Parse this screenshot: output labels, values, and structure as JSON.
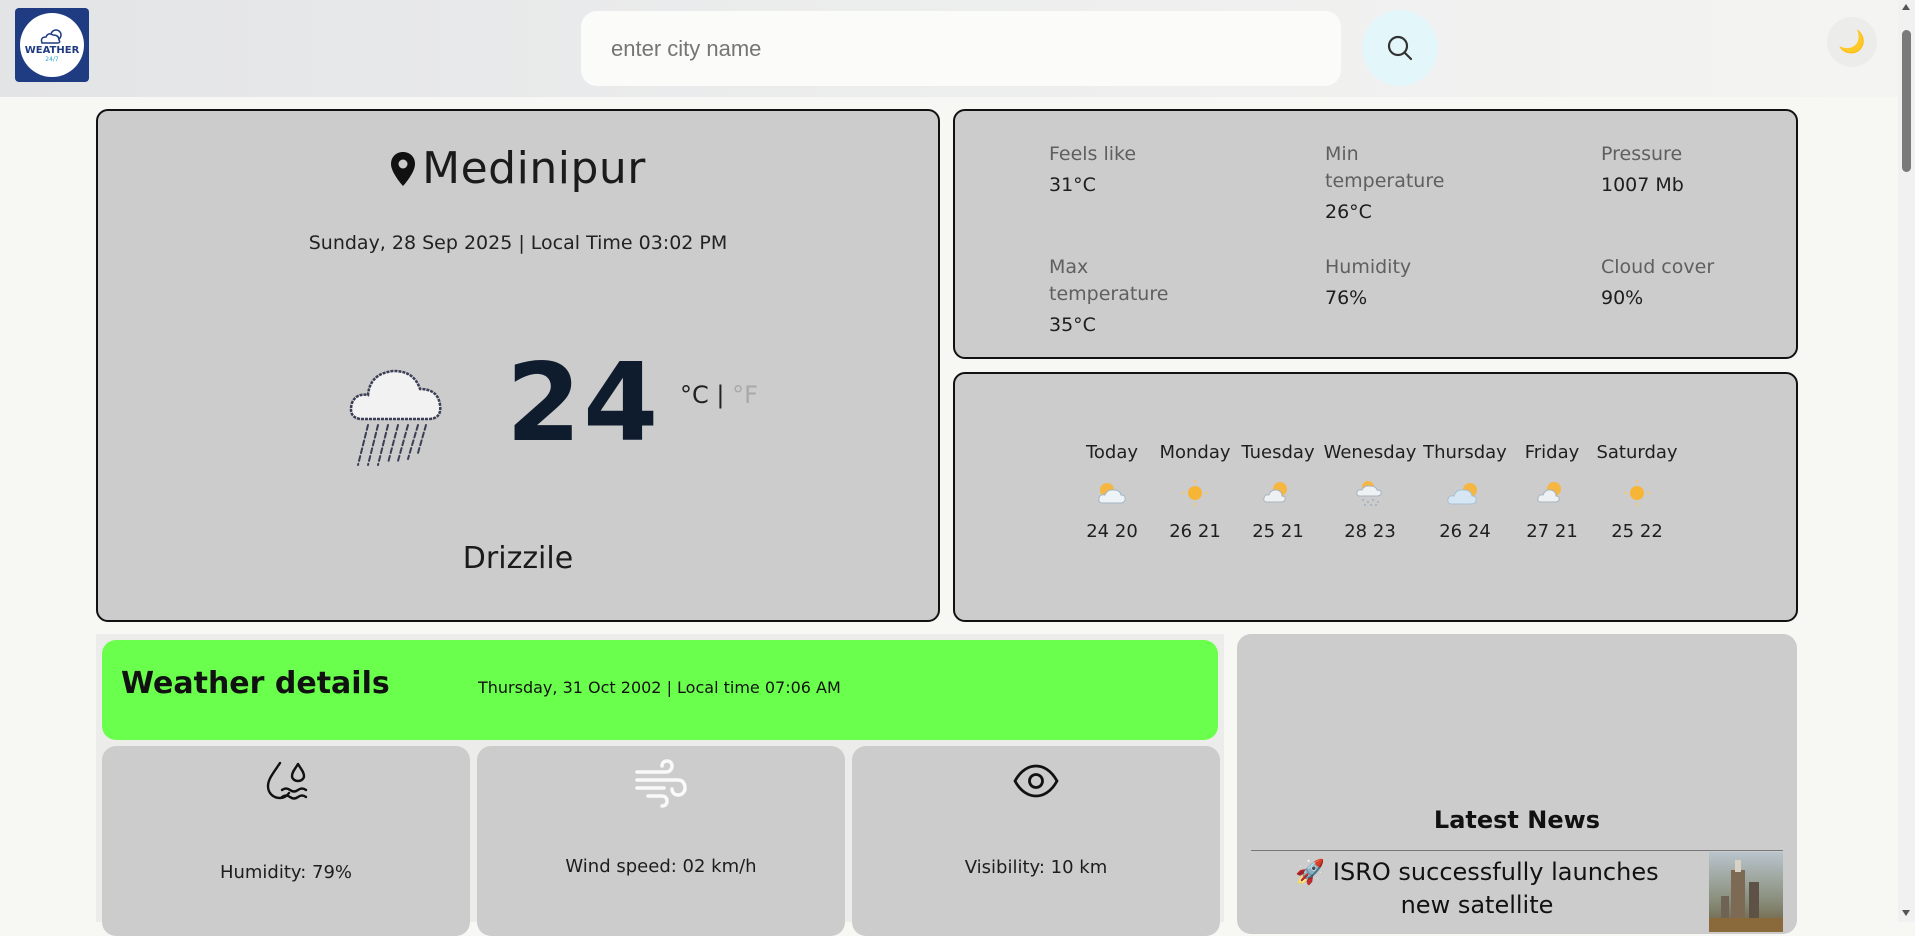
{
  "header": {
    "logo_text": "WEATHER",
    "logo_sub": "24/7",
    "search_placeholder": "enter city name",
    "search_icon": "search-icon",
    "theme_icon": "moon-icon"
  },
  "current": {
    "city": "Medinipur",
    "date_time": "Sunday, 28 Sep 2025 | Local Time 03:02 PM",
    "temperature": "24",
    "unit_c": "°C",
    "unit_sep": "|",
    "unit_f": "°F",
    "condition": "Drizzile",
    "icon": "cloud-rain-icon"
  },
  "stats": {
    "feels_like": {
      "label": "Feels like",
      "value": "31°C"
    },
    "min_temp": {
      "label": "Min temperature",
      "value": "26°C"
    },
    "pressure": {
      "label": "Pressure",
      "value": "1007 Mb"
    },
    "max_temp": {
      "label": "Max temperature",
      "value": "35°C"
    },
    "humidity": {
      "label": "Humidity",
      "value": "76%"
    },
    "cloud_cover": {
      "label": "Cloud cover",
      "value": "90%"
    }
  },
  "forecast": [
    {
      "day": "Today",
      "temps": "24 20",
      "icon": "partly-cloudy-icon"
    },
    {
      "day": "Monday",
      "temps": "26 21",
      "icon": "sun-icon"
    },
    {
      "day": "Tuesday",
      "temps": "25 21",
      "icon": "sun-cloud-icon"
    },
    {
      "day": "Wenesday",
      "temps": "28 23",
      "icon": "snow-cloud-icon"
    },
    {
      "day": "Thursday",
      "temps": "26 24",
      "icon": "cloud-sun-icon"
    },
    {
      "day": "Friday",
      "temps": "27 21",
      "icon": "sun-cloud-icon"
    },
    {
      "day": "Saturday",
      "temps": "25 22",
      "icon": "sun-icon"
    }
  ],
  "details": {
    "title": "Weather details",
    "date_time": "Thursday, 31 Oct 2002 | Local time 07:06 AM",
    "humidity": "Humidity: 79%",
    "wind": "Wind speed: 02 km/h",
    "visibility": "Visibility: 10 km"
  },
  "news": {
    "title": "Latest News",
    "items": [
      {
        "emoji": "🚀",
        "headline": "ISRO successfully launches new satellite"
      }
    ]
  },
  "colors": {
    "accent_green": "#6bff4d",
    "card_gray": "#cccccc",
    "search_btn": "#e3f7fa"
  }
}
